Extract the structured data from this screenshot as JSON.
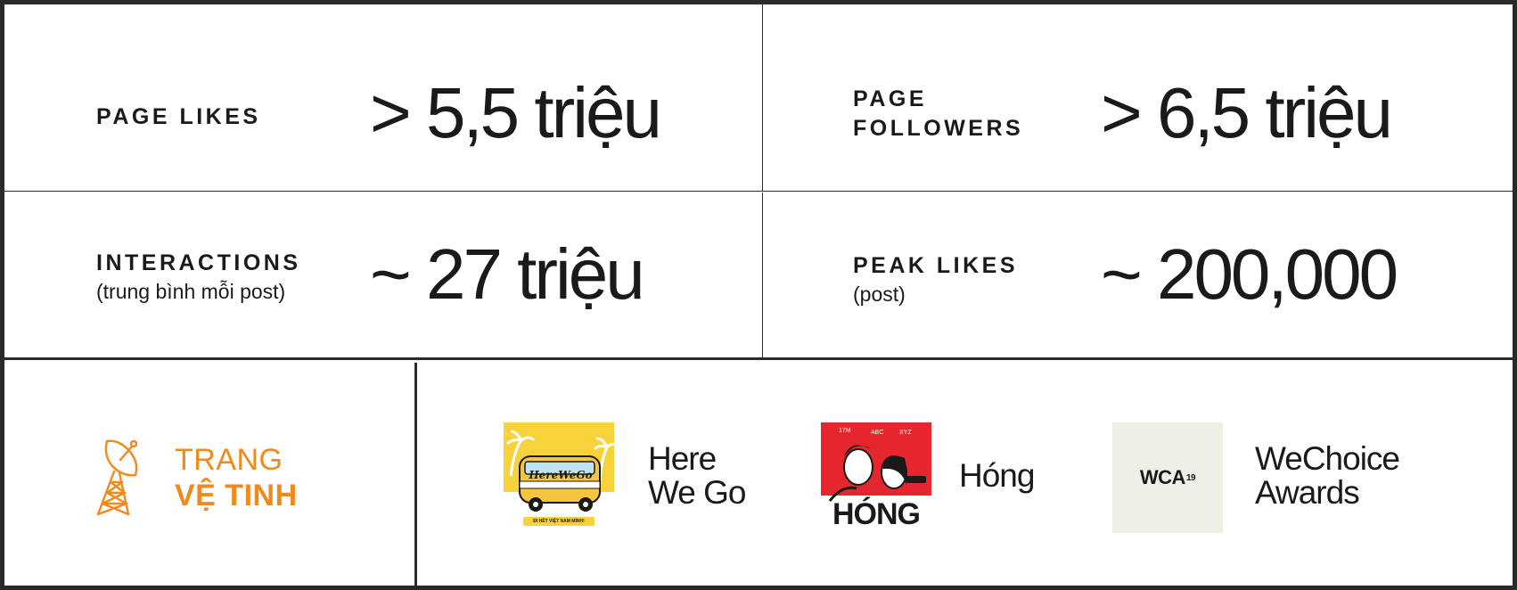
{
  "stats": {
    "page_likes": {
      "label": "PAGE LIKES",
      "value": "> 5,5 triệu"
    },
    "page_followers": {
      "label_line1": "PAGE",
      "label_line2": "FOLLOWERS",
      "value": "> 6,5 triệu"
    },
    "interactions": {
      "label": "INTERACTIONS",
      "sub": "(trung bình mỗi post)",
      "value": "~ 27 triệu"
    },
    "peak_likes": {
      "label": "PEAK LIKES",
      "sub": "(post)",
      "value": "~ 200,000"
    }
  },
  "brand": {
    "line1": "TRANG",
    "line2": "VỆ TINH",
    "icon": "satellite-dish-icon",
    "color": "#f08a1c"
  },
  "partners": [
    {
      "name_line1": "Here",
      "name_line2": "We Go",
      "thumb_title": "HereWeGo",
      "thumb_caption": "ĐI HẾT VIỆT NAM MÌNH!"
    },
    {
      "name": "Hóng",
      "thumb_title": "HÓNG",
      "thumb_tags": [
        "17M",
        "ABC",
        "XYZ"
      ]
    },
    {
      "name_line1": "WeChoice",
      "name_line2": "Awards",
      "thumb_title": "WCA",
      "thumb_sup": "19"
    }
  ]
}
